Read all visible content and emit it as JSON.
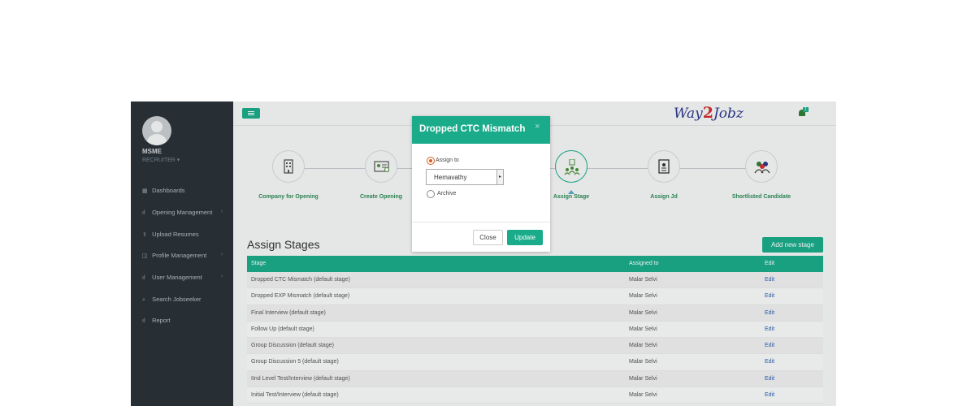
{
  "user": {
    "name": "MSME",
    "role": "RECRUITER ▾"
  },
  "nav": [
    {
      "icon": "▦",
      "label": "Dashboards",
      "chevron": ""
    },
    {
      "icon": "ıl",
      "label": "Opening Management",
      "chevron": "‹"
    },
    {
      "icon": "⇪",
      "label": "Upload Resumes",
      "chevron": ""
    },
    {
      "icon": "◫",
      "label": "Profile Management",
      "chevron": "‹"
    },
    {
      "icon": "ıl",
      "label": "User Management",
      "chevron": "‹"
    },
    {
      "icon": "⌕",
      "label": "Search Jobseeker",
      "chevron": ""
    },
    {
      "icon": "ıl",
      "label": "Report",
      "chevron": ""
    }
  ],
  "logo": {
    "left": "Way",
    "mid": "2",
    "right": "Jobz"
  },
  "notifications": {
    "count": "1"
  },
  "steps": [
    {
      "label": "Company for Opening",
      "icon": "building-icon"
    },
    {
      "label": "Create Opening",
      "icon": "id-card-icon"
    },
    {
      "label": "Assign Stage",
      "icon": "stage-people-icon"
    },
    {
      "label": "Assign Jd",
      "icon": "document-icon"
    },
    {
      "label": "Shortlisted Candidate",
      "icon": "group-icon"
    }
  ],
  "section": {
    "title": "Assign Stages",
    "add_button": "Add new stage"
  },
  "table": {
    "headers": [
      "Stage",
      "Assigned to",
      "Edit"
    ],
    "rows": [
      [
        "Dropped CTC Mismatch (default stage)",
        "Malar Selvi",
        "Edit"
      ],
      [
        "Dropped EXP Mismatch (default stage)",
        "Malar Selvi",
        "Edit"
      ],
      [
        "Final Interview (default stage)",
        "Malar Selvi",
        "Edit"
      ],
      [
        "Follow Up (default stage)",
        "Malar Selvi",
        "Edit"
      ],
      [
        "Group Discussion (default stage)",
        "Malar Selvi",
        "Edit"
      ],
      [
        "Group Discussion 5 (default stage)",
        "Malar Selvi",
        "Edit"
      ],
      [
        "IInd Level Test/Interview (default stage)",
        "Malar Selvi",
        "Edit"
      ],
      [
        "Initial Test/Interview (default stage)",
        "Malar Selvi",
        "Edit"
      ]
    ]
  },
  "modal": {
    "title": "Dropped CTC Mismatch",
    "close_symbol": "×",
    "option_assign": "Assign to",
    "selected_user": "Hemavathy",
    "option_archive": "Archive",
    "close_button": "Close",
    "update_button": "Update"
  },
  "colors": {
    "accent": "#1aab8a",
    "sidebar": "#2a3239",
    "radio": "#d95c1f"
  }
}
